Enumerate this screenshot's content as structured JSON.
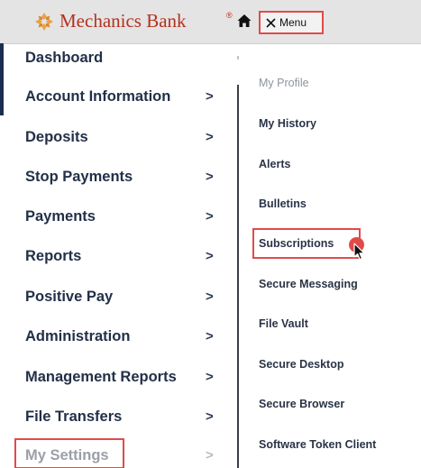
{
  "header": {
    "bank_name": "Mechanics Bank",
    "registered_mark": "®",
    "menu_label": "Menu",
    "brand_color": "#b4321f"
  },
  "nav": {
    "items": [
      {
        "label": "Dashboard",
        "chevron": ""
      },
      {
        "label": "Account Information",
        "chevron": ">"
      },
      {
        "label": "Deposits",
        "chevron": ">"
      },
      {
        "label": "Stop Payments",
        "chevron": ">"
      },
      {
        "label": "Payments",
        "chevron": ">"
      },
      {
        "label": "Reports",
        "chevron": ">"
      },
      {
        "label": "Positive Pay",
        "chevron": ">"
      },
      {
        "label": "Administration",
        "chevron": ">"
      },
      {
        "label": "Management Reports",
        "chevron": ">"
      },
      {
        "label": "File Transfers",
        "chevron": ">"
      },
      {
        "label": "My Settings",
        "chevron": ">"
      }
    ]
  },
  "submenu": {
    "items": [
      {
        "label": "My Profile"
      },
      {
        "label": "My History"
      },
      {
        "label": "Alerts"
      },
      {
        "label": "Bulletins"
      },
      {
        "label": "Subscriptions"
      },
      {
        "label": "Secure Messaging"
      },
      {
        "label": "File Vault"
      },
      {
        "label": "Secure Desktop"
      },
      {
        "label": "Secure Browser"
      },
      {
        "label": "Software Token Client"
      }
    ]
  },
  "colors": {
    "highlight": "#e24a4a",
    "nav_text": "#223048",
    "muted_text": "#9aa0a8"
  }
}
